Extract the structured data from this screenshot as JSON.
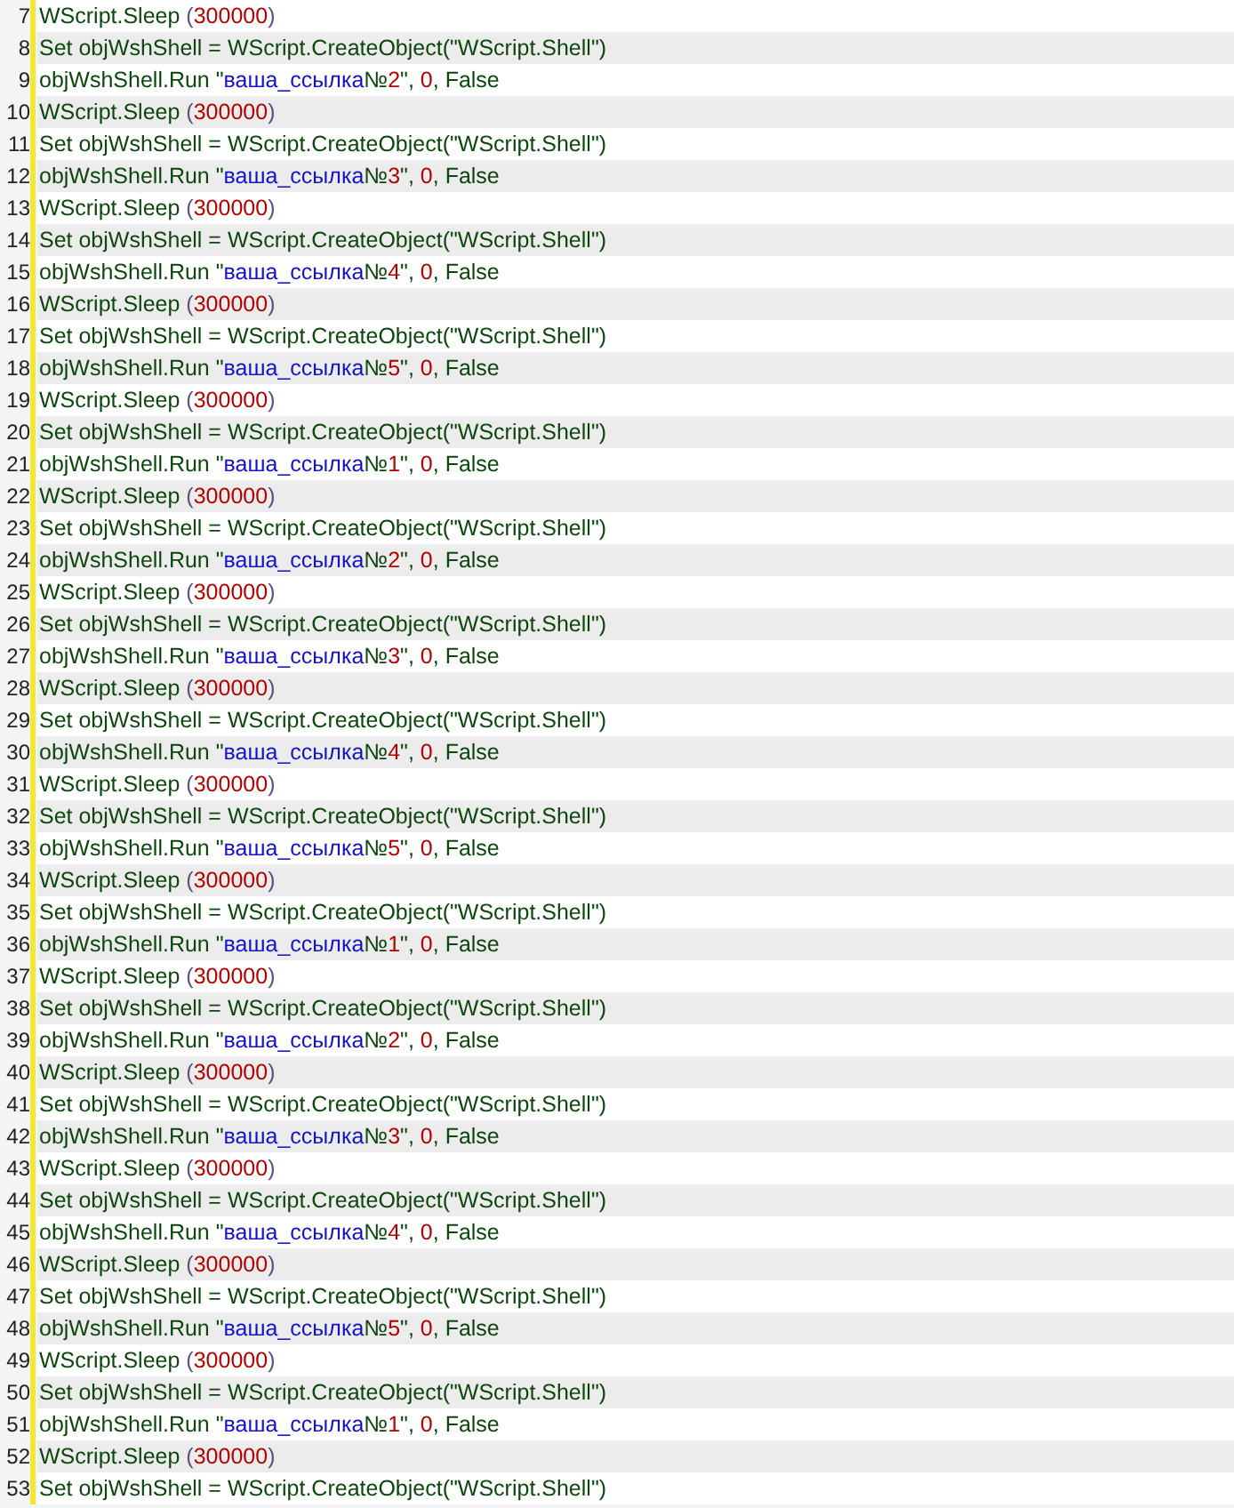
{
  "editor": {
    "lines": [
      {
        "number": "7",
        "tokens": [
          {
            "kind": "plain",
            "text": "WScript.Sleep "
          },
          {
            "kind": "paren",
            "text": "("
          },
          {
            "kind": "number",
            "text": "300000"
          },
          {
            "kind": "paren",
            "text": ")"
          }
        ]
      },
      {
        "number": "8",
        "tokens": [
          {
            "kind": "plain",
            "text": "Set objWshShell = WScript.CreateObject(\"WScript.Shell\")"
          }
        ]
      },
      {
        "number": "9",
        "tokens": [
          {
            "kind": "plain",
            "text": "objWshShell.Run \""
          },
          {
            "kind": "string",
            "text": "ваша_ссылка"
          },
          {
            "kind": "plain",
            "text": "№"
          },
          {
            "kind": "number",
            "text": "2"
          },
          {
            "kind": "plain",
            "text": "\", "
          },
          {
            "kind": "number",
            "text": "0"
          },
          {
            "kind": "plain",
            "text": ", False"
          }
        ]
      },
      {
        "number": "10",
        "tokens": [
          {
            "kind": "plain",
            "text": "WScript.Sleep "
          },
          {
            "kind": "paren",
            "text": "("
          },
          {
            "kind": "number",
            "text": "300000"
          },
          {
            "kind": "paren",
            "text": ")"
          }
        ]
      },
      {
        "number": "11",
        "tokens": [
          {
            "kind": "plain",
            "text": "Set objWshShell = WScript.CreateObject(\"WScript.Shell\")"
          }
        ]
      },
      {
        "number": "12",
        "tokens": [
          {
            "kind": "plain",
            "text": "objWshShell.Run \""
          },
          {
            "kind": "string",
            "text": "ваша_ссылка"
          },
          {
            "kind": "plain",
            "text": "№"
          },
          {
            "kind": "number",
            "text": "3"
          },
          {
            "kind": "plain",
            "text": "\", "
          },
          {
            "kind": "number",
            "text": "0"
          },
          {
            "kind": "plain",
            "text": ", False"
          }
        ]
      },
      {
        "number": "13",
        "tokens": [
          {
            "kind": "plain",
            "text": "WScript.Sleep "
          },
          {
            "kind": "paren",
            "text": "("
          },
          {
            "kind": "number",
            "text": "300000"
          },
          {
            "kind": "paren",
            "text": ")"
          }
        ]
      },
      {
        "number": "14",
        "tokens": [
          {
            "kind": "plain",
            "text": "Set objWshShell = WScript.CreateObject(\"WScript.Shell\")"
          }
        ]
      },
      {
        "number": "15",
        "tokens": [
          {
            "kind": "plain",
            "text": "objWshShell.Run \""
          },
          {
            "kind": "string",
            "text": "ваша_ссылка"
          },
          {
            "kind": "plain",
            "text": "№"
          },
          {
            "kind": "number",
            "text": "4"
          },
          {
            "kind": "plain",
            "text": "\", "
          },
          {
            "kind": "number",
            "text": "0"
          },
          {
            "kind": "plain",
            "text": ", False"
          }
        ]
      },
      {
        "number": "16",
        "tokens": [
          {
            "kind": "plain",
            "text": "WScript.Sleep "
          },
          {
            "kind": "paren",
            "text": "("
          },
          {
            "kind": "number",
            "text": "300000"
          },
          {
            "kind": "paren",
            "text": ")"
          }
        ]
      },
      {
        "number": "17",
        "tokens": [
          {
            "kind": "plain",
            "text": "Set objWshShell = WScript.CreateObject(\"WScript.Shell\")"
          }
        ]
      },
      {
        "number": "18",
        "tokens": [
          {
            "kind": "plain",
            "text": "objWshShell.Run \""
          },
          {
            "kind": "string",
            "text": "ваша_ссылка"
          },
          {
            "kind": "plain",
            "text": "№"
          },
          {
            "kind": "number",
            "text": "5"
          },
          {
            "kind": "plain",
            "text": "\", "
          },
          {
            "kind": "number",
            "text": "0"
          },
          {
            "kind": "plain",
            "text": ", False"
          }
        ]
      },
      {
        "number": "19",
        "tokens": [
          {
            "kind": "plain",
            "text": "WScript.Sleep "
          },
          {
            "kind": "paren",
            "text": "("
          },
          {
            "kind": "number",
            "text": "300000"
          },
          {
            "kind": "paren",
            "text": ")"
          }
        ]
      },
      {
        "number": "20",
        "tokens": [
          {
            "kind": "plain",
            "text": "Set objWshShell = WScript.CreateObject(\"WScript.Shell\")"
          }
        ]
      },
      {
        "number": "21",
        "tokens": [
          {
            "kind": "plain",
            "text": "objWshShell.Run \""
          },
          {
            "kind": "string",
            "text": "ваша_ссылка"
          },
          {
            "kind": "plain",
            "text": "№"
          },
          {
            "kind": "number",
            "text": "1"
          },
          {
            "kind": "plain",
            "text": "\", "
          },
          {
            "kind": "number",
            "text": "0"
          },
          {
            "kind": "plain",
            "text": ", False"
          }
        ]
      },
      {
        "number": "22",
        "tokens": [
          {
            "kind": "plain",
            "text": "WScript.Sleep "
          },
          {
            "kind": "paren",
            "text": "("
          },
          {
            "kind": "number",
            "text": "300000"
          },
          {
            "kind": "paren",
            "text": ")"
          }
        ]
      },
      {
        "number": "23",
        "tokens": [
          {
            "kind": "plain",
            "text": "Set objWshShell = WScript.CreateObject(\"WScript.Shell\")"
          }
        ]
      },
      {
        "number": "24",
        "tokens": [
          {
            "kind": "plain",
            "text": "objWshShell.Run \""
          },
          {
            "kind": "string",
            "text": "ваша_ссылка"
          },
          {
            "kind": "plain",
            "text": "№"
          },
          {
            "kind": "number",
            "text": "2"
          },
          {
            "kind": "plain",
            "text": "\", "
          },
          {
            "kind": "number",
            "text": "0"
          },
          {
            "kind": "plain",
            "text": ", False"
          }
        ]
      },
      {
        "number": "25",
        "tokens": [
          {
            "kind": "plain",
            "text": "WScript.Sleep "
          },
          {
            "kind": "paren",
            "text": "("
          },
          {
            "kind": "number",
            "text": "300000"
          },
          {
            "kind": "paren",
            "text": ")"
          }
        ]
      },
      {
        "number": "26",
        "tokens": [
          {
            "kind": "plain",
            "text": "Set objWshShell = WScript.CreateObject(\"WScript.Shell\")"
          }
        ]
      },
      {
        "number": "27",
        "tokens": [
          {
            "kind": "plain",
            "text": "objWshShell.Run \""
          },
          {
            "kind": "string",
            "text": "ваша_ссылка"
          },
          {
            "kind": "plain",
            "text": "№"
          },
          {
            "kind": "number",
            "text": "3"
          },
          {
            "kind": "plain",
            "text": "\", "
          },
          {
            "kind": "number",
            "text": "0"
          },
          {
            "kind": "plain",
            "text": ", False"
          }
        ]
      },
      {
        "number": "28",
        "tokens": [
          {
            "kind": "plain",
            "text": "WScript.Sleep "
          },
          {
            "kind": "paren",
            "text": "("
          },
          {
            "kind": "number",
            "text": "300000"
          },
          {
            "kind": "paren",
            "text": ")"
          }
        ]
      },
      {
        "number": "29",
        "tokens": [
          {
            "kind": "plain",
            "text": "Set objWshShell = WScript.CreateObject(\"WScript.Shell\")"
          }
        ]
      },
      {
        "number": "30",
        "tokens": [
          {
            "kind": "plain",
            "text": "objWshShell.Run \""
          },
          {
            "kind": "string",
            "text": "ваша_ссылка"
          },
          {
            "kind": "plain",
            "text": "№"
          },
          {
            "kind": "number",
            "text": "4"
          },
          {
            "kind": "plain",
            "text": "\", "
          },
          {
            "kind": "number",
            "text": "0"
          },
          {
            "kind": "plain",
            "text": ", False"
          }
        ]
      },
      {
        "number": "31",
        "tokens": [
          {
            "kind": "plain",
            "text": "WScript.Sleep "
          },
          {
            "kind": "paren",
            "text": "("
          },
          {
            "kind": "number",
            "text": "300000"
          },
          {
            "kind": "paren",
            "text": ")"
          }
        ]
      },
      {
        "number": "32",
        "tokens": [
          {
            "kind": "plain",
            "text": "Set objWshShell = WScript.CreateObject(\"WScript.Shell\")"
          }
        ]
      },
      {
        "number": "33",
        "tokens": [
          {
            "kind": "plain",
            "text": "objWshShell.Run \""
          },
          {
            "kind": "string",
            "text": "ваша_ссылка"
          },
          {
            "kind": "plain",
            "text": "№"
          },
          {
            "kind": "number",
            "text": "5"
          },
          {
            "kind": "plain",
            "text": "\", "
          },
          {
            "kind": "number",
            "text": "0"
          },
          {
            "kind": "plain",
            "text": ", False"
          }
        ]
      },
      {
        "number": "34",
        "tokens": [
          {
            "kind": "plain",
            "text": "WScript.Sleep "
          },
          {
            "kind": "paren",
            "text": "("
          },
          {
            "kind": "number",
            "text": "300000"
          },
          {
            "kind": "paren",
            "text": ")"
          }
        ]
      },
      {
        "number": "35",
        "tokens": [
          {
            "kind": "plain",
            "text": "Set objWshShell = WScript.CreateObject(\"WScript.Shell\")"
          }
        ]
      },
      {
        "number": "36",
        "tokens": [
          {
            "kind": "plain",
            "text": "objWshShell.Run \""
          },
          {
            "kind": "string",
            "text": "ваша_ссылка"
          },
          {
            "kind": "plain",
            "text": "№"
          },
          {
            "kind": "number",
            "text": "1"
          },
          {
            "kind": "plain",
            "text": "\", "
          },
          {
            "kind": "number",
            "text": "0"
          },
          {
            "kind": "plain",
            "text": ", False"
          }
        ]
      },
      {
        "number": "37",
        "tokens": [
          {
            "kind": "plain",
            "text": "WScript.Sleep "
          },
          {
            "kind": "paren",
            "text": "("
          },
          {
            "kind": "number",
            "text": "300000"
          },
          {
            "kind": "paren",
            "text": ")"
          }
        ]
      },
      {
        "number": "38",
        "tokens": [
          {
            "kind": "plain",
            "text": "Set objWshShell = WScript.CreateObject(\"WScript.Shell\")"
          }
        ]
      },
      {
        "number": "39",
        "tokens": [
          {
            "kind": "plain",
            "text": "objWshShell.Run \""
          },
          {
            "kind": "string",
            "text": "ваша_ссылка"
          },
          {
            "kind": "plain",
            "text": "№"
          },
          {
            "kind": "number",
            "text": "2"
          },
          {
            "kind": "plain",
            "text": "\", "
          },
          {
            "kind": "number",
            "text": "0"
          },
          {
            "kind": "plain",
            "text": ", False"
          }
        ]
      },
      {
        "number": "40",
        "tokens": [
          {
            "kind": "plain",
            "text": "WScript.Sleep "
          },
          {
            "kind": "paren",
            "text": "("
          },
          {
            "kind": "number",
            "text": "300000"
          },
          {
            "kind": "paren",
            "text": ")"
          }
        ]
      },
      {
        "number": "41",
        "tokens": [
          {
            "kind": "plain",
            "text": "Set objWshShell = WScript.CreateObject(\"WScript.Shell\")"
          }
        ]
      },
      {
        "number": "42",
        "tokens": [
          {
            "kind": "plain",
            "text": "objWshShell.Run \""
          },
          {
            "kind": "string",
            "text": "ваша_ссылка"
          },
          {
            "kind": "plain",
            "text": "№"
          },
          {
            "kind": "number",
            "text": "3"
          },
          {
            "kind": "plain",
            "text": "\", "
          },
          {
            "kind": "number",
            "text": "0"
          },
          {
            "kind": "plain",
            "text": ", False"
          }
        ]
      },
      {
        "number": "43",
        "tokens": [
          {
            "kind": "plain",
            "text": "WScript.Sleep "
          },
          {
            "kind": "paren",
            "text": "("
          },
          {
            "kind": "number",
            "text": "300000"
          },
          {
            "kind": "paren",
            "text": ")"
          }
        ]
      },
      {
        "number": "44",
        "tokens": [
          {
            "kind": "plain",
            "text": "Set objWshShell = WScript.CreateObject(\"WScript.Shell\")"
          }
        ]
      },
      {
        "number": "45",
        "tokens": [
          {
            "kind": "plain",
            "text": "objWshShell.Run \""
          },
          {
            "kind": "string",
            "text": "ваша_ссылка"
          },
          {
            "kind": "plain",
            "text": "№"
          },
          {
            "kind": "number",
            "text": "4"
          },
          {
            "kind": "plain",
            "text": "\", "
          },
          {
            "kind": "number",
            "text": "0"
          },
          {
            "kind": "plain",
            "text": ", False"
          }
        ]
      },
      {
        "number": "46",
        "tokens": [
          {
            "kind": "plain",
            "text": "WScript.Sleep "
          },
          {
            "kind": "paren",
            "text": "("
          },
          {
            "kind": "number",
            "text": "300000"
          },
          {
            "kind": "paren",
            "text": ")"
          }
        ]
      },
      {
        "number": "47",
        "tokens": [
          {
            "kind": "plain",
            "text": "Set objWshShell = WScript.CreateObject(\"WScript.Shell\")"
          }
        ]
      },
      {
        "number": "48",
        "tokens": [
          {
            "kind": "plain",
            "text": "objWshShell.Run \""
          },
          {
            "kind": "string",
            "text": "ваша_ссылка"
          },
          {
            "kind": "plain",
            "text": "№"
          },
          {
            "kind": "number",
            "text": "5"
          },
          {
            "kind": "plain",
            "text": "\", "
          },
          {
            "kind": "number",
            "text": "0"
          },
          {
            "kind": "plain",
            "text": ", False"
          }
        ]
      },
      {
        "number": "49",
        "tokens": [
          {
            "kind": "plain",
            "text": "WScript.Sleep "
          },
          {
            "kind": "paren",
            "text": "("
          },
          {
            "kind": "number",
            "text": "300000"
          },
          {
            "kind": "paren",
            "text": ")"
          }
        ]
      },
      {
        "number": "50",
        "tokens": [
          {
            "kind": "plain",
            "text": "Set objWshShell = WScript.CreateObject(\"WScript.Shell\")"
          }
        ]
      },
      {
        "number": "51",
        "tokens": [
          {
            "kind": "plain",
            "text": "objWshShell.Run \""
          },
          {
            "kind": "string",
            "text": "ваша_ссылка"
          },
          {
            "kind": "plain",
            "text": "№"
          },
          {
            "kind": "number",
            "text": "1"
          },
          {
            "kind": "plain",
            "text": "\", "
          },
          {
            "kind": "number",
            "text": "0"
          },
          {
            "kind": "plain",
            "text": ", False"
          }
        ]
      },
      {
        "number": "52",
        "tokens": [
          {
            "kind": "plain",
            "text": "WScript.Sleep "
          },
          {
            "kind": "paren",
            "text": "("
          },
          {
            "kind": "number",
            "text": "300000"
          },
          {
            "kind": "paren",
            "text": ")"
          }
        ]
      },
      {
        "number": "53",
        "tokens": [
          {
            "kind": "plain",
            "text": "Set objWshShell = WScript.CreateObject(\"WScript.Shell\")"
          }
        ]
      }
    ]
  }
}
